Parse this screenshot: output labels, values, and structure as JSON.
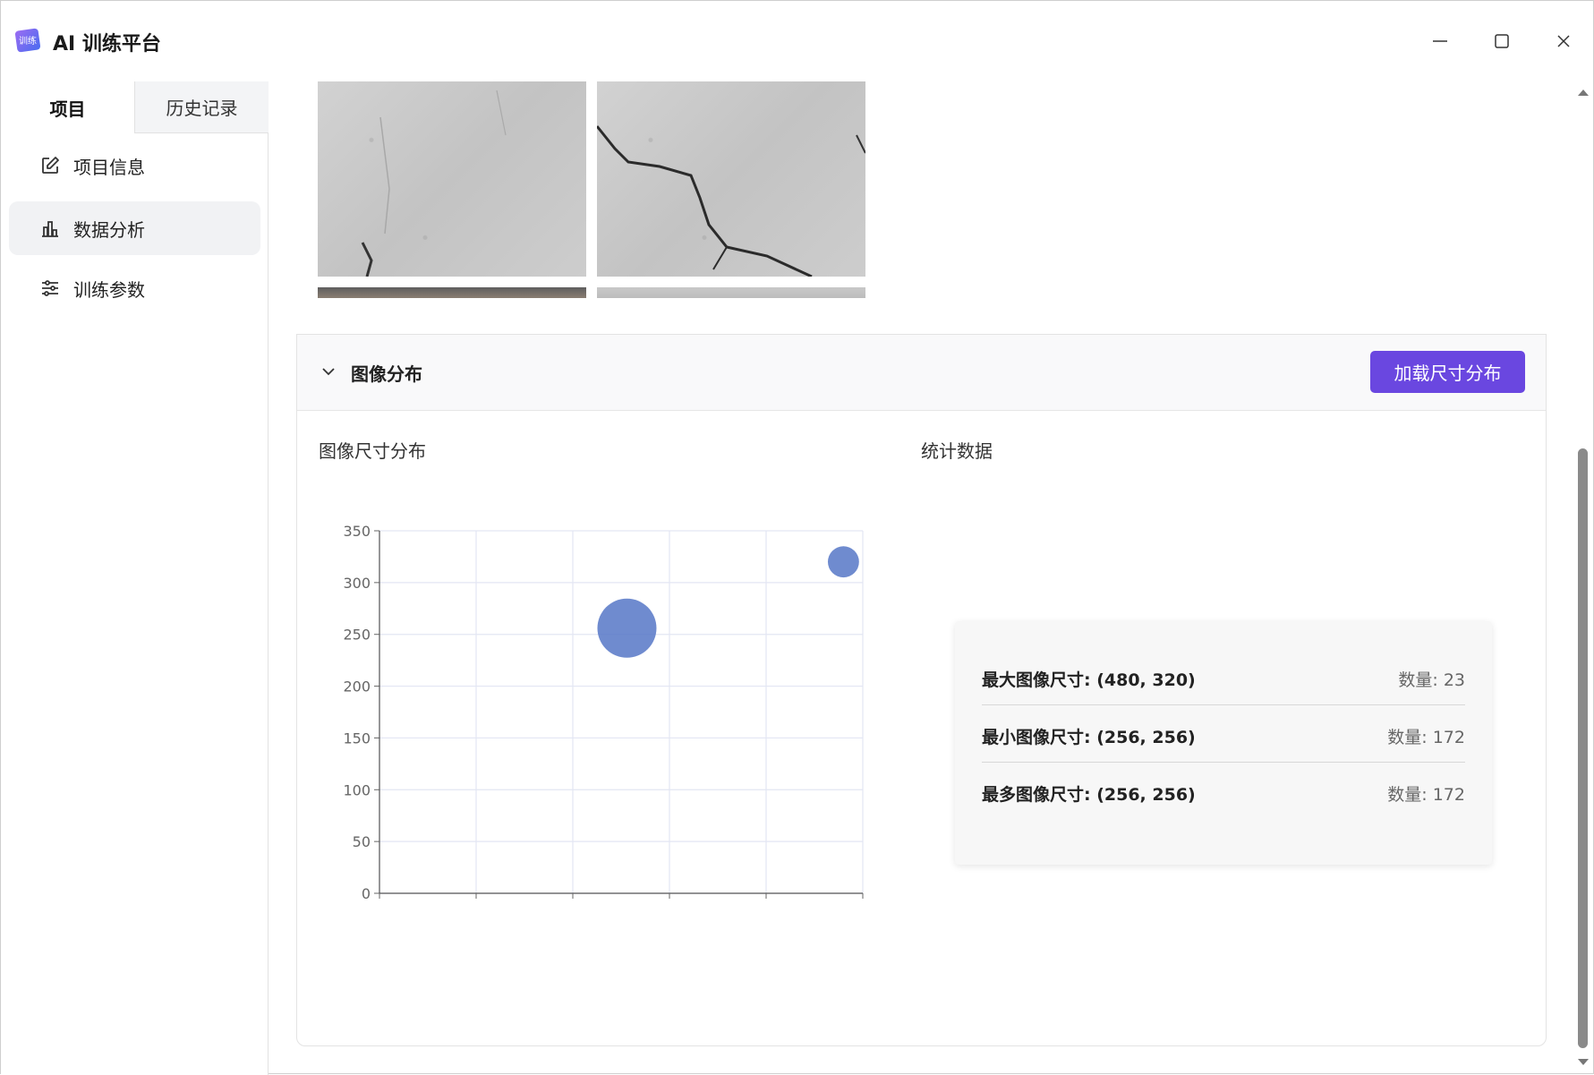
{
  "app": {
    "title": "AI 训练平台",
    "logo_text": "训练"
  },
  "sidebar": {
    "tabs": [
      {
        "label": "项目"
      },
      {
        "label": "历史记录"
      }
    ],
    "items": [
      {
        "label": "项目信息",
        "icon": "edit-icon"
      },
      {
        "label": "数据分析",
        "icon": "bar-chart-icon",
        "active": true
      },
      {
        "label": "训练参数",
        "icon": "sliders-icon"
      }
    ]
  },
  "section": {
    "title": "图像分布",
    "load_button": "加载尺寸分布",
    "chart_label": "图像尺寸分布",
    "stats_label": "统计数据"
  },
  "stats": [
    {
      "label": "最大图像尺寸: (480, 320)",
      "count": "数量: 23"
    },
    {
      "label": "最小图像尺寸: (256, 256)",
      "count": "数量: 172"
    },
    {
      "label": "最多图像尺寸: (256, 256)",
      "count": "数量: 172"
    }
  ],
  "chart_data": {
    "type": "scatter",
    "xlim": [
      0,
      500
    ],
    "ylim": [
      0,
      350
    ],
    "x_ticks": [
      0,
      100,
      200,
      300,
      400,
      500
    ],
    "y_ticks": [
      0,
      50,
      100,
      150,
      200,
      250,
      300,
      350
    ],
    "grid": true,
    "color": "#5b7bc8",
    "points": [
      {
        "x": 256,
        "y": 256,
        "count": 172
      },
      {
        "x": 480,
        "y": 320,
        "count": 23
      }
    ]
  }
}
